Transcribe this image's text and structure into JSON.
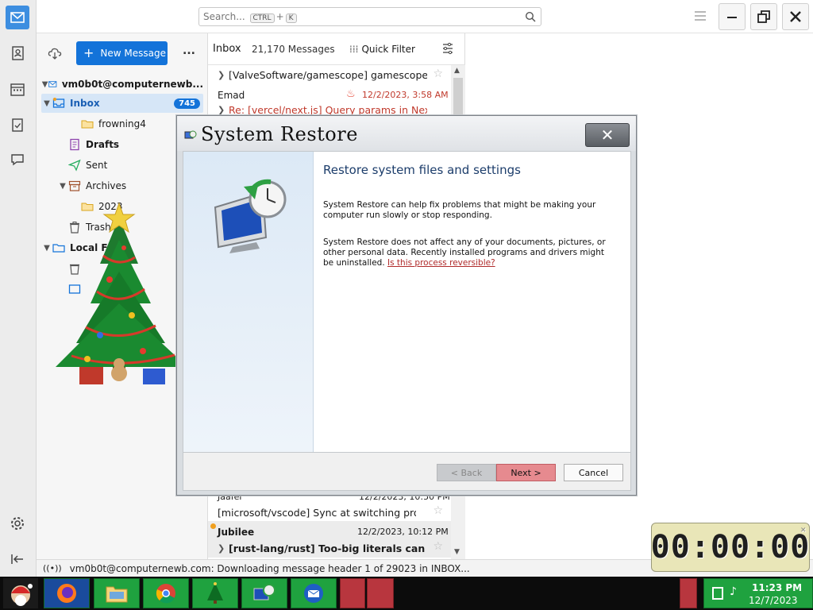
{
  "app": {
    "search_placeholder": "Search...",
    "search_kbd_1": "CTRL",
    "search_kbd_plus": "+",
    "search_kbd_2": "K"
  },
  "folder_pane": {
    "new_message_label": "New Message",
    "more_label": "...",
    "account": "vm0b0t@computernewb...",
    "items": [
      {
        "label": "Inbox",
        "badge": "745"
      },
      {
        "label": "frowning4"
      },
      {
        "label": "Drafts"
      },
      {
        "label": "Sent"
      },
      {
        "label": "Archives"
      },
      {
        "label": "2023"
      },
      {
        "label": "Trash"
      },
      {
        "label": "Local F"
      }
    ]
  },
  "message_list": {
    "title": "Inbox",
    "count": "21,170 Messages",
    "quick_filter": "Quick Filter",
    "rows": [
      {
        "subject": "[ValveSoftware/gamescope] gamescope..."
      },
      {
        "sender": "Emad",
        "date": "12/2/2023, 3:58 AM",
        "subject": "Re: [vercel/next.js] Query params in Nextj..."
      },
      {
        "sender": "Jaafer",
        "date": "12/2/2023, 10:50 PM",
        "subject": "[microsoft/vscode] Sync at switching profil..."
      },
      {
        "sender": "Jubilee",
        "date": "12/2/2023, 10:12 PM",
        "subject": "[rust-lang/rust] Too-big literals can b..."
      }
    ]
  },
  "status_bar": {
    "text": "vm0b0t@computernewb.com: Downloading message header 1 of 29023 in INBOX..."
  },
  "dialog": {
    "title": "System Restore",
    "heading": "Restore system files and settings",
    "paragraph_1": "System Restore can help fix problems that might be making your computer run slowly or stop responding.",
    "paragraph_2": "System Restore does not affect any of your documents, pictures, or other personal data. Recently installed programs and drivers might be uninstalled.",
    "link": "Is this process reversible?",
    "back_label": "< Back",
    "next_label": "Next >",
    "cancel_label": "Cancel"
  },
  "timer": {
    "value": "00:00:00"
  },
  "taskbar": {
    "clock_time": "11:23 PM",
    "clock_date": "12/7/2023"
  },
  "colors": {
    "accent": "#1373d9",
    "taskbar_green": "#1fa23f",
    "taskbar_red": "#b8363e",
    "unread_red": "#c0392b"
  }
}
